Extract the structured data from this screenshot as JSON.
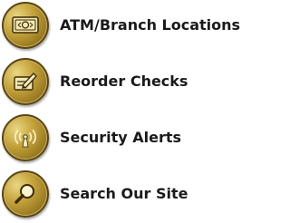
{
  "menu": {
    "items": [
      {
        "label": "ATM/Branch Locations",
        "icon": "atm-card-icon"
      },
      {
        "label": "Reorder Checks",
        "icon": "check-pen-icon"
      },
      {
        "label": "Security Alerts",
        "icon": "alert-signal-icon"
      },
      {
        "label": "Search Our Site",
        "icon": "search-icon"
      }
    ]
  },
  "colors": {
    "icon_gold": "#c6a43c",
    "icon_dark": "#5a4512",
    "text": "#1a1a1a"
  }
}
